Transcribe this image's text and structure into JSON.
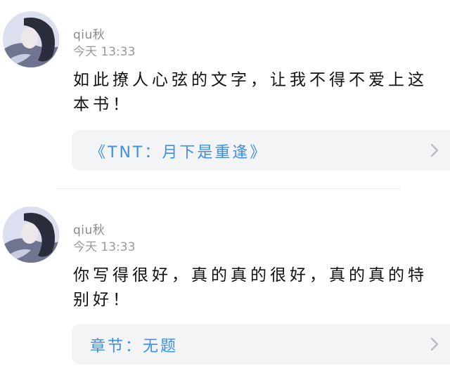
{
  "comments": [
    {
      "username": "qiu秋",
      "timestamp": "今天 13:33",
      "text": "如此撩人心弦的文字，让我不得不爱上这本书！",
      "link": "《TNT：月下是重逢》",
      "avatar_icon": "avatar-photo",
      "chevron_icon": "chevron-right-icon"
    },
    {
      "username": "qiu秋",
      "timestamp": "今天 13:33",
      "text": "你写得很好，真的真的很好，真的真的特别好！",
      "link": "章节：无题",
      "avatar_icon": "avatar-photo",
      "chevron_icon": "chevron-right-icon"
    }
  ],
  "colors": {
    "link": "#3d8ee6",
    "card_background": "#f3f4f6",
    "meta_text": "#8a8a8a"
  }
}
